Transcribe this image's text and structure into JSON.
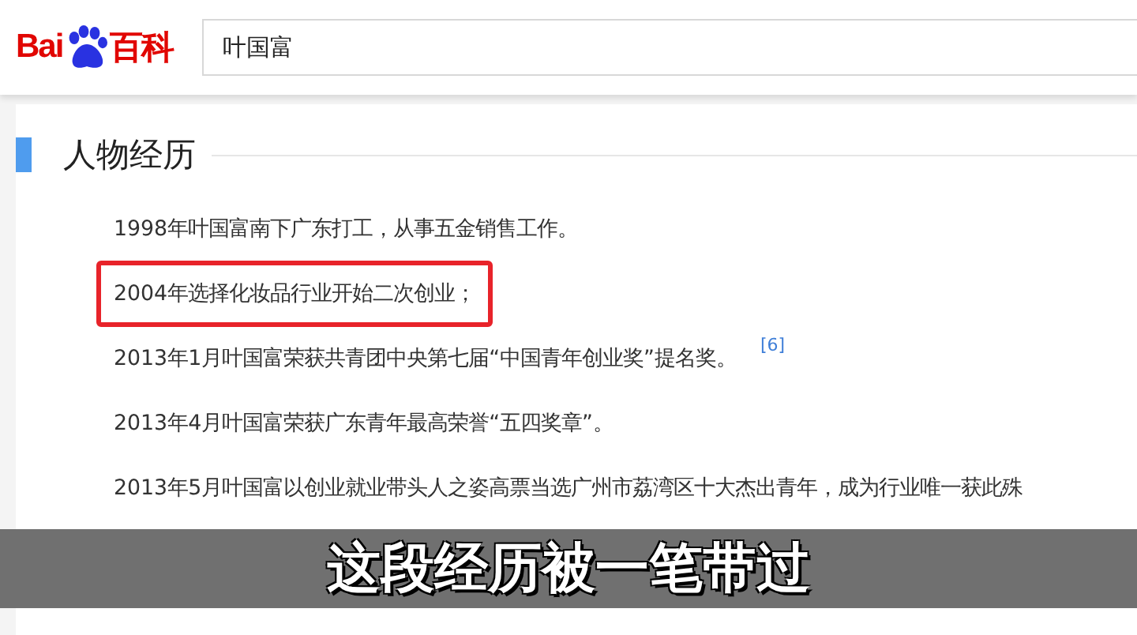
{
  "header": {
    "logo": {
      "left": "Bai",
      "right": "百科"
    },
    "search": {
      "value": "叶国富"
    }
  },
  "section": {
    "heading": "人物经历",
    "items": [
      {
        "text": "1998年叶国富南下广东打工，从事五金销售工作。",
        "highlighted": false
      },
      {
        "text": "2004年选择化妆品行业开始二次创业；",
        "highlighted": true
      },
      {
        "text": "2013年1月叶国富荣获共青团中央第七届“中国青年创业奖”提名奖。",
        "highlighted": false,
        "ref": "[6]"
      },
      {
        "text": "2013年4月叶国富荣获广东青年最高荣誉“五四奖章”。",
        "highlighted": false
      },
      {
        "text": "2013年5月叶国富以创业就业带头人之姿高票当选广州市荔湾区十大杰出青年，成为行业唯一获此殊",
        "highlighted": false
      }
    ]
  },
  "subtitle": "这段经历被一笔带过"
}
